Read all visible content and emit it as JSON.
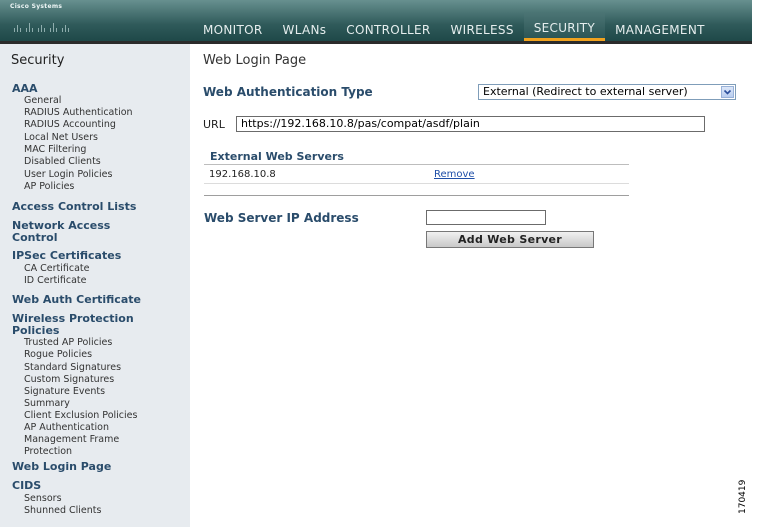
{
  "header": {
    "logo_text": "Cisco Systems",
    "nav": [
      {
        "label": "MONITOR",
        "active": false
      },
      {
        "label": "WLANs",
        "active": false
      },
      {
        "label": "CONTROLLER",
        "active": false
      },
      {
        "label": "WIRELESS",
        "active": false
      },
      {
        "label": "SECURITY",
        "active": true
      },
      {
        "label": "MANAGEMENT",
        "active": false
      }
    ]
  },
  "sidebar": {
    "title": "Security",
    "aaa": {
      "label": "AAA",
      "items": [
        "General",
        "RADIUS Authentication",
        "RADIUS Accounting",
        "Local Net Users",
        "MAC Filtering",
        "Disabled Clients",
        "User Login Policies",
        "AP Policies"
      ]
    },
    "acl": "Access Control Lists",
    "nac": "Network Access Control",
    "ipsec": {
      "label": "IPSec Certificates",
      "items": [
        "CA Certificate",
        "ID Certificate"
      ]
    },
    "web_auth_cert": "Web Auth Certificate",
    "wps": {
      "label": "Wireless Protection Policies",
      "items": [
        "Trusted AP Policies",
        "Rogue Policies",
        "Standard Signatures",
        "Custom Signatures",
        "Signature Events Summary",
        "Client Exclusion Policies",
        "AP Authentication",
        "Management Frame Protection"
      ]
    },
    "web_login": "Web Login Page",
    "cids": {
      "label": "CIDS",
      "items": [
        "Sensors",
        "Shunned Clients"
      ]
    }
  },
  "main": {
    "page_title": "Web Login Page",
    "web_auth_type_label": "Web Authentication Type",
    "web_auth_type_value": "External (Redirect to external server)",
    "url_label": "URL",
    "url_value": "https://192.168.10.8/pas/compat/asdf/plain",
    "external_servers_heading": "External Web Servers",
    "servers": [
      {
        "ip": "192.168.10.8",
        "action": "Remove"
      }
    ],
    "web_server_ip_label": "Web Server IP Address",
    "web_server_ip_value": "",
    "add_button_label": "Add Web Server"
  },
  "figure_id": "170419"
}
